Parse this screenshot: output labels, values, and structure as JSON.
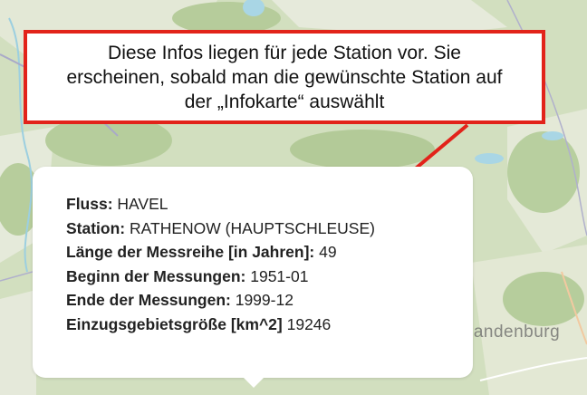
{
  "callout": {
    "lines": [
      "Diese Infos liegen für jede Station vor. Sie",
      "erscheinen, sobald man die gewünschte Station auf",
      "der „Infokarte“ auswählt"
    ]
  },
  "popup": {
    "rows": [
      {
        "label": "Fluss:",
        "value": "HAVEL"
      },
      {
        "label": "Station:",
        "value": "RATHENOW (HAUPTSCHLEUSE)"
      },
      {
        "label": "Länge der Messreihe [in Jahren]:",
        "value": "49"
      },
      {
        "label": "Beginn der Messungen:",
        "value": "1951-01"
      },
      {
        "label": "Ende der Messungen:",
        "value": "1999-12"
      },
      {
        "label": "Einzugsgebietsgröße [km^2]",
        "value": "19246"
      }
    ]
  },
  "map": {
    "place_label": "randenburg"
  },
  "colors": {
    "callout_border": "#e2231a",
    "arrow": "#e2231a",
    "map_green": "#b9cfa0",
    "map_light": "#e2e9d2",
    "water": "#a9d6e5"
  }
}
